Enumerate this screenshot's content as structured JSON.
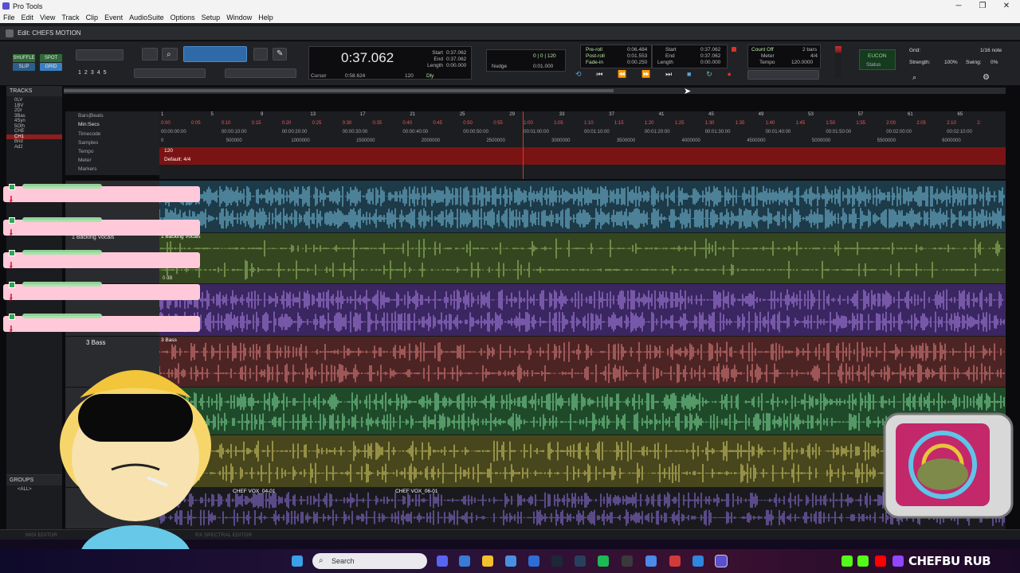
{
  "window": {
    "app_title": "Pro Tools",
    "edit_title": "Edit: CHEFS MOTION",
    "controls": [
      "─",
      "❐",
      "✕"
    ]
  },
  "menu": [
    "File",
    "Edit",
    "View",
    "Track",
    "Clip",
    "Event",
    "AudioSuite",
    "Options",
    "Setup",
    "Window",
    "Help"
  ],
  "toolbar": {
    "modes": {
      "shuffle": "SHUFFLE",
      "spot": "SPOT",
      "slip": "SLIP",
      "grid": "GRID"
    },
    "zoom_presets": [
      "1",
      "2",
      "3",
      "4",
      "5"
    ],
    "main_counter": "0:37.062",
    "cursor_label": "Cursor",
    "cursor_value": "0:58.624",
    "selection": {
      "start_label": "Start",
      "start": "0:37.062",
      "end_label": "End",
      "end": "0:37.062",
      "length_label": "Length",
      "length": "0:00.000"
    },
    "tempo_field": "120",
    "dly_label": "Dly",
    "nudge_label": "Nudge",
    "nudge_value": "0:01.000",
    "grid_top": "0 | 0 | 120",
    "pre_post": {
      "preroll_label": "Pre-roll",
      "preroll": "0:06.484",
      "postroll_label": "Post-roll",
      "postroll": "0:01.553",
      "fadein_label": "Fade-in",
      "fadein": "0:00.250"
    },
    "transport_sel": {
      "start_label": "Start",
      "start": "0:37.062",
      "end_label": "End",
      "end": "0:37.062",
      "length_label": "Length",
      "length": "0:00.000"
    },
    "countoff": {
      "countoff_label": "Count Off",
      "countoff": "2 bars",
      "meter_label": "Meter",
      "meter": "4/4",
      "tempo_label": "Tempo",
      "tempo": "120.0000"
    },
    "eucon": {
      "label": "EUCON",
      "status": "Status"
    },
    "grid": {
      "label": "Grid:",
      "value": "1/16 note"
    },
    "strength": {
      "label": "Strength:",
      "value": "100%"
    },
    "swing": {
      "label": "Swing:",
      "value": "0%"
    }
  },
  "rulers": {
    "labels": [
      "Bars|Beats",
      "Min:Secs",
      "Timecode",
      "Samples",
      "Tempo",
      "Meter",
      "Markers"
    ],
    "bars": [
      "1",
      "5",
      "9",
      "13",
      "17",
      "21",
      "25",
      "29",
      "33",
      "37",
      "41",
      "45",
      "49",
      "53",
      "57",
      "61",
      "65"
    ],
    "minsecs": [
      "0:00",
      "0:05",
      "0:10",
      "0:15",
      "0:20",
      "0:25",
      "0:30",
      "0:35",
      "0:40",
      "0:45",
      "0:50",
      "0:55",
      "1:00",
      "1:05",
      "1:10",
      "1:15",
      "1:20",
      "1:25",
      "1:30",
      "1:35",
      "1:40",
      "1:45",
      "1:50",
      "1:55",
      "2:00",
      "2:05",
      "2:10",
      "2:"
    ],
    "timecode": [
      "00:00:00:00",
      "00:00:10:00",
      "00:00:20:00",
      "00:00:30:00",
      "00:00:40:00",
      "00:00:50:00",
      "00:01:00:00",
      "00:01:10:00",
      "00:01:20:00",
      "00:01:30:00",
      "00:01:40:00",
      "00:01:50:00",
      "00:02:00:00",
      "00:02:10:00"
    ],
    "samples": [
      "0",
      "500000",
      "1000000",
      "1500000",
      "2000000",
      "2500000",
      "3000000",
      "3500000",
      "4000000",
      "4500000",
      "5000000",
      "5500000",
      "6000000"
    ],
    "tempo_value": "120",
    "meter_value": "Default: 4/4"
  },
  "tracks_panel": {
    "title": "TRACKS",
    "items": [
      "0LV",
      "1BV",
      "2Dr",
      "3Bas",
      "4Syn",
      "5Oth",
      "CHE",
      "CH1",
      "Bnd",
      "Ad2"
    ]
  },
  "groups_panel": {
    "title": "GROUPS",
    "items": [
      "<ALL>"
    ]
  },
  "tracks": [
    {
      "name": "",
      "clip": "",
      "color": "#4aa3c8"
    },
    {
      "name": "1 Backing Vocals",
      "clip": "1 Backing Vocals",
      "color": "#6f9440",
      "volume": "0 dB"
    },
    {
      "name": "",
      "clip": "",
      "color": "#8a4fd0"
    },
    {
      "name": "3 Bass",
      "clip": "3 Bass",
      "color": "#d45a5a"
    },
    {
      "name": "",
      "clip": "",
      "color": "#4cbf6a"
    },
    {
      "name": "",
      "clip": "",
      "color": "#b8b040"
    },
    {
      "name": "",
      "clip_a": "CHEF VOX_04-01",
      "clip_b": "CHEF VOX_06-01",
      "color": "#7b4fd8"
    }
  ],
  "bottom_tabs": [
    "MIDI EDITOR",
    "RX SPECTRAL EDITOR"
  ],
  "taskbar": {
    "search_placeholder": "Search",
    "brand": "CHEFBU RUB"
  }
}
